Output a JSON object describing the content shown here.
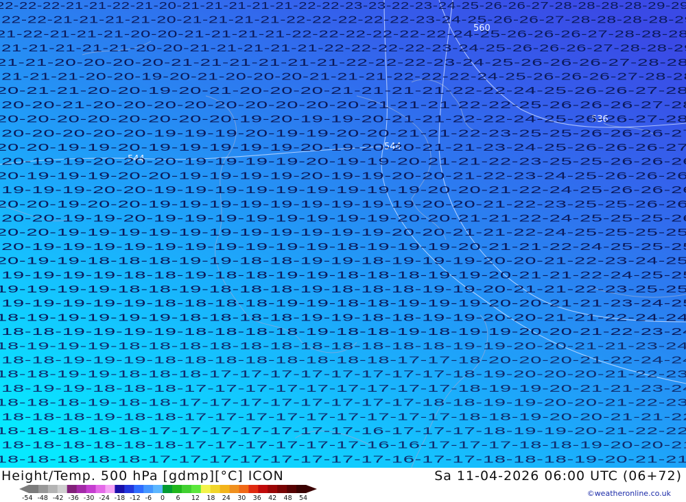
{
  "title_left": "Height/Temp. 500 hPa [gdmp][°C] ICON",
  "title_right": "Sa 11-04-2026 06:00 UTC (06+72)",
  "credit": "©weatheronline.co.uk",
  "legend": {
    "ticks": [
      "-54",
      "-48",
      "-42",
      "-36",
      "-30",
      "-24",
      "-18",
      "-12",
      "-6",
      "0",
      "6",
      "12",
      "18",
      "24",
      "30",
      "36",
      "42",
      "48",
      "54"
    ],
    "colors": [
      "#7b7b7b",
      "#979797",
      "#b3b3b3",
      "#cfcfcf",
      "#82207a",
      "#a32aa8",
      "#c53ed0",
      "#e46ae8",
      "#f5a3f5",
      "#1a0fa8",
      "#2236dc",
      "#2f6cff",
      "#4496ff",
      "#5cb6ff",
      "#049b32",
      "#21b71c",
      "#40d030",
      "#5be83c",
      "#f3f34a",
      "#f1d52a",
      "#f3b41a",
      "#f0901e",
      "#f06816",
      "#e02a10",
      "#c00a0a",
      "#9a0606",
      "#780404",
      "#560203",
      "#3a0202"
    ]
  },
  "map": {
    "gradient": [
      "#07e8ff",
      "#13c8ff",
      "#1ea4fa",
      "#2a82f1",
      "#3462ec",
      "#3a4ae6"
    ],
    "contour_labels": [
      "536",
      "544",
      "552",
      "560"
    ],
    "rows": [
      "22-22-22-21-21-22-21-20-21-21-21-21-21-22-22-23-23-22-23-24-25-26-26-27-28-28-28-28-29-29",
      "22-22-21-21-21-21-20-21-21-21-21-22-22-22-22-22-23-24-25-26-26-27-28-28-28-28-29",
      "21-22-21-21-21-20-20-21-21-21-21-22-22-22-22-22-22-24-25-26-26-26-27-28-28-28",
      "21-21-21-21-21-20-20-21-21-21-21-21-22-22-22-22-23-24-25-26-26-26-27-28-28-29",
      "21-21-20-20-20-20-21-21-21-21-21-21-22-22-22-23-24-25-26-26-26-27-28-28",
      "21-21-21-20-20-19-20-21-20-20-20-21-21-21-22-22-22-24-25-26-26-26-27-28-28",
      "20-21-21-20-20-19-20-21-20-20-20-21-21-21-21-22-22-24-25-26-26-27-28",
      "20-20-21-20-20-20-20-20-20-20-20-20-21-21-21-22-22-25-26-26-26-27-28",
      "20-20-20-20-20-20-20-20-19-20-19-19-20-21-21-22-22-24-25-26-26-27-28",
      "20-20-20-20-20-19-19-19-20-19-19-20-20-21-21-22-23-25-25-26-26-26-27",
      "20-20-19-19-20-19-19-19-19-19-20-19-20-20-21-21-23-24-25-26-26-26-27",
      "20-19-19-20-20-20-19-19-19-19-20-19-19-20-21-21-22-23-25-25-26-26-26",
      "20-19-19-19-20-20-19-19-19-19-20-19-19-20-20-21-22-23-24-25-26-26-26",
      "19-19-19-20-20-19-19-19-19-19-19-19-19-19-20-20-21-22-24-25-26-26-26",
      "20-20-19-20-20-19-19-19-19-19-19-19-19-19-20-20-21-22-23-25-25-26-26",
      "20-20-19-19-20-19-19-19-19-19-19-19-19-20-20-21-21-22-24-25-25-25-26",
      "20-20-19-19-19-19-19-19-19-19-19-19-19-20-20-21-21-22-24-25-25-25-25",
      "20-19-19-19-19-19-19-19-19-19-19-18-19-19-19-20-21-21-22-24-25-25-25",
      "20-19-19-18-18-18-19-19-18-18-19-19-18-19-19-19-20-20-21-22-23-24-25",
      "19-19-19-19-18-18-19-18-18-19-19-18-18-18-19-19-20-21-21-22-24-25-25",
      "19-19-19-19-18-18-19-18-18-18-19-18-18-18-19-19-20-21-21-22-23-25-25",
      "19-19-19-19-19-18-18-18-18-19-19-18-18-19-19-19-20-20-21-21-23-24-25",
      "18-19-19-19-19-19-18-18-18-18-19-19-18-18-19-19-20-20-21-21-22-24-24",
      "18-18-19-19-19-19-18-18-18-18-19-18-18-19-18-19-19-20-20-21-22-23-24",
      "18-19-19-19-18-18-18-18-18-18-18-18-18-18-18-19-19-20-20-21-21-23-24",
      "18-18-19-19-19-18-18-18-18-18-18-18-18-17-17-18-20-20-20-21-22-24-24",
      "18-18-19-19-18-18-18-17-17-17-17-17-17-17-17-18-19-20-20-20-21-22-23",
      "18-19-19-18-18-18-17-17-17-17-17-17-17-17-17-18-19-19-20-21-21-23-24",
      "18-18-18-19-18-18-17-17-17-17-17-17-17-17-18-18-19-19-20-20-21-22-23",
      "18-18-18-19-18-18-17-17-17-17-17-17-17-17-17-18-18-19-20-20-21-21-22",
      "18-18-18-18-18-17-17-17-17-17-17-17-16-17-17-17-18-19-19-20-21-22-22",
      "18-18-18-18-18-18-17-17-17-17-17-17-16-16-17-17-17-18-18-19-20-20-21",
      "18-18-18-18-18-17-17-17-17-17-17-17-17-16-17-17-18-18-18-19-20-21-21"
    ]
  }
}
